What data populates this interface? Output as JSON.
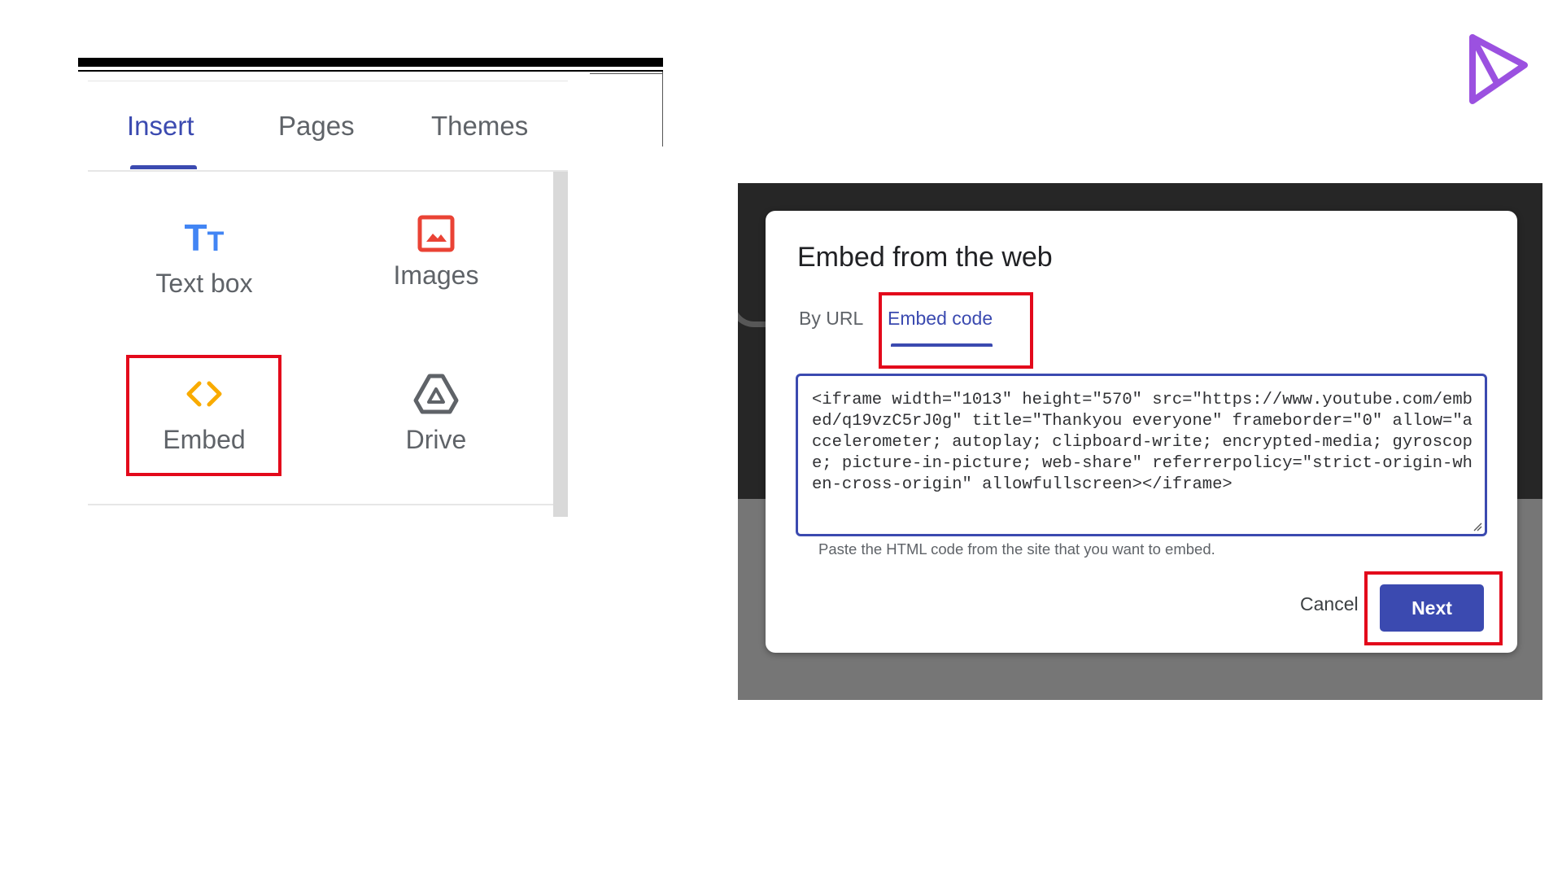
{
  "insert_panel": {
    "tabs": [
      {
        "label": "Insert",
        "active": true
      },
      {
        "label": "Pages",
        "active": false
      },
      {
        "label": "Themes",
        "active": false
      }
    ],
    "tiles": [
      {
        "label": "Text box",
        "icon": "text-box-icon"
      },
      {
        "label": "Images",
        "icon": "image-icon"
      },
      {
        "label": "Embed",
        "icon": "embed-code-icon",
        "highlighted": true
      },
      {
        "label": "Drive",
        "icon": "drive-icon"
      }
    ],
    "textbox_icon": {
      "big": "T",
      "small": "T"
    }
  },
  "dialog": {
    "title": "Embed from the web",
    "tabs": [
      {
        "label": "By URL",
        "active": false
      },
      {
        "label": "Embed code",
        "active": true,
        "highlighted": true
      }
    ],
    "code": "<iframe width=\"1013\" height=\"570\" src=\"https://www.youtube.com/embed/q19vzC5rJ0g\" title=\"Thankyou everyone\" frameborder=\"0\" allow=\"accelerometer; autoplay; clipboard-write; encrypted-media; gyroscope; picture-in-picture; web-share\" referrerpolicy=\"strict-origin-when-cross-origin\" allowfullscreen></iframe>",
    "helper_text": "Paste the HTML code from the site that you want to embed.",
    "cancel_label": "Cancel",
    "next_label": "Next"
  },
  "colors": {
    "accent": "#3b4ab0",
    "highlight": "#e3091b",
    "text_box_icon": "#4285f4",
    "image_icon": "#ea4335",
    "embed_icon": "#f9ab00",
    "logo": "#9b51e0"
  }
}
